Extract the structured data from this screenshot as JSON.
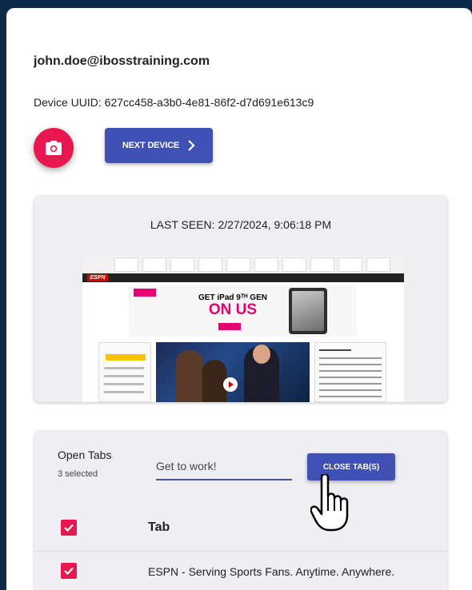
{
  "device": {
    "email": "john.doe@ibosstraining.com",
    "uuid_label": "Device UUID: 627cc458-a3b0-4e81-86f2-d7d691e613c9",
    "next_device_label": "NEXT DEVICE"
  },
  "screenshot": {
    "last_seen": "LAST SEEN: 2/27/2024, 9:06:18 PM",
    "espn_logo": "ESPN",
    "ad_headline": "GET iPad 9ᵀᴴ GEN",
    "ad_subline": "ON US"
  },
  "tabs": {
    "title": "Open Tabs",
    "selected_count": "3 selected",
    "message_value": "Get to work!",
    "close_button_label": "CLOSE TAB(S)",
    "column_header": "Tab",
    "rows": [
      {
        "title": "ESPN - Serving Sports Fans. Anytime. Anywhere.",
        "checked": true
      }
    ]
  },
  "colors": {
    "accent_blue": "#3f51b5",
    "accent_pink": "#e8174f",
    "background_navy": "#0d2a4a"
  },
  "icons": [
    "camera-icon",
    "chevron-right-icon",
    "check-icon",
    "hand-pointer-icon"
  ]
}
